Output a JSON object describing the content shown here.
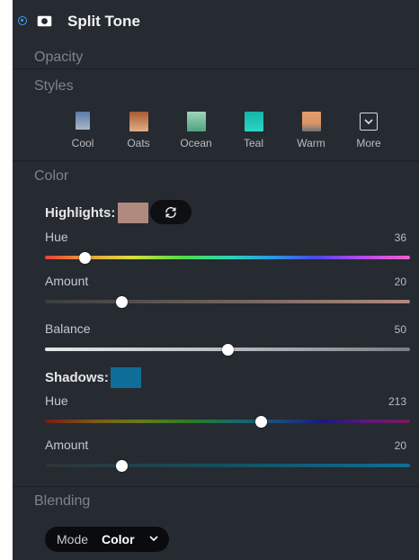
{
  "panel": {
    "title": "Split Tone"
  },
  "sections": {
    "opacity": "Opacity",
    "styles": "Styles",
    "color": "Color",
    "blending": "Blending"
  },
  "styles": [
    {
      "label": "Cool",
      "color_top": "#5b7ca8",
      "color_bottom": "#a9b8c8"
    },
    {
      "label": "Oats",
      "color_top": "#a85a33",
      "color_bottom": "#e2b086"
    },
    {
      "label": "Ocean",
      "color_top": "#6fb7a0",
      "color_bottom": "#4da47e"
    },
    {
      "label": "Teal",
      "color_top": "#17b3a5",
      "color_bottom": "#2ad6c8"
    },
    {
      "label": "Warm",
      "color_top": "#e39c6a",
      "color_bottom": "#6b707a"
    },
    {
      "label": "More",
      "icon": "chevron-down-box-icon"
    }
  ],
  "highlights": {
    "label": "Highlights:",
    "color": "#b08a7e",
    "hue": {
      "label": "Hue",
      "value": "36",
      "fraction": 0.11
    },
    "amount": {
      "label": "Amount",
      "value": "20",
      "fraction": 0.21
    }
  },
  "balance": {
    "label": "Balance",
    "value": "50",
    "fraction": 0.5
  },
  "shadows": {
    "label": "Shadows:",
    "color": "#0e6e98",
    "hue": {
      "label": "Hue",
      "value": "213",
      "fraction": 0.593
    },
    "amount": {
      "label": "Amount",
      "value": "20",
      "fraction": 0.211
    }
  },
  "blending": {
    "mode_label": "Mode",
    "mode_value": "Color"
  },
  "colors": {
    "accent": "#3aa0ff",
    "panel_bg": "#262a31"
  }
}
